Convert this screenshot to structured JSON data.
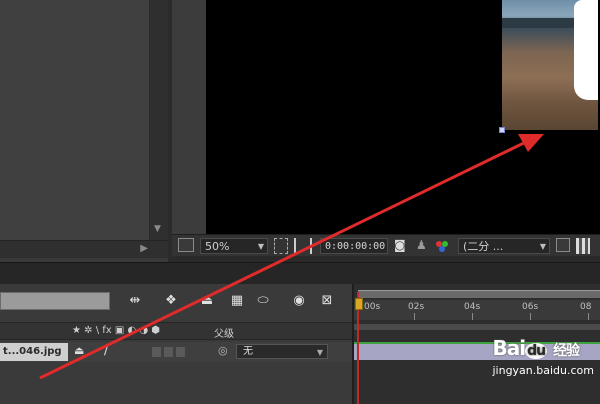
{
  "viewer": {
    "zoom": "50%",
    "timecode": "0:00:00:00",
    "resolution": "(二分 ..."
  },
  "timeline": {
    "ruler_ticks": [
      "00s",
      "02s",
      "04s",
      "06s",
      "08"
    ],
    "columns": {
      "switches": "★ ✲ \\ fx ▣ ◐ ◑ ⬢",
      "parent": "父级"
    },
    "layer": {
      "name": "t...046.jpg",
      "parent_value": "无"
    }
  },
  "watermark": {
    "logo_a": "Bai",
    "logo_b": "百度",
    "logo_c": "经验",
    "url": "jingyan.baidu.com"
  },
  "colors": {
    "panel_bg": "#3a3a3a",
    "canvas_bg": "#000000",
    "annotation_arrow": "#e02b2b",
    "playhead": "#c0282a",
    "layer_bar": "#a6a6c4"
  }
}
